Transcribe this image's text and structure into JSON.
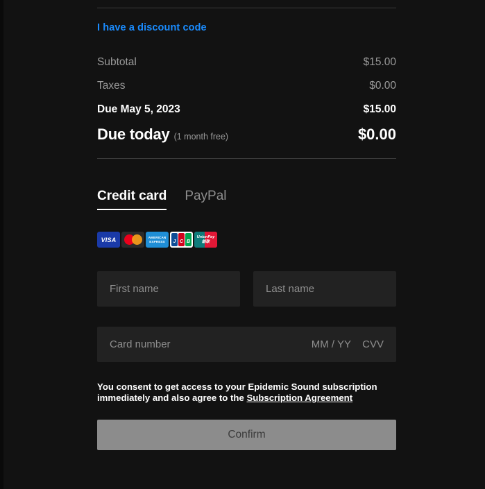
{
  "colors": {
    "background": "#121212",
    "link_blue": "#1a8cff",
    "muted_text": "#9a9a9a",
    "field_bg": "#222222",
    "confirm_bg": "#8c8c8c",
    "divider": "#3a3a3a"
  },
  "discount": {
    "link_label": "I have a discount code"
  },
  "summary": {
    "rows": [
      {
        "label": "Subtotal",
        "value": "$15.00"
      },
      {
        "label": "Taxes",
        "value": "$0.00"
      },
      {
        "label": "Due May 5, 2023",
        "value": "$15.00"
      }
    ],
    "total": {
      "label": "Due today",
      "note": "(1 month free)",
      "value": "$0.00"
    }
  },
  "payment": {
    "tabs": [
      {
        "label": "Credit card",
        "active": true
      },
      {
        "label": "PayPal",
        "active": false
      }
    ],
    "brands": [
      {
        "name": "visa-card-icon",
        "text": "VISA"
      },
      {
        "name": "mastercard-card-icon",
        "text": ""
      },
      {
        "name": "amex-card-icon",
        "line1": "AMERICAN",
        "line2": "EXPRESS"
      },
      {
        "name": "jcb-card-icon",
        "letters": [
          "J",
          "C",
          "B"
        ]
      },
      {
        "name": "unionpay-card-icon",
        "line1": "UnionPay",
        "line2": "銀联"
      }
    ]
  },
  "form": {
    "first_name": {
      "placeholder": "First name",
      "value": ""
    },
    "last_name": {
      "placeholder": "Last name",
      "value": ""
    },
    "card_number": {
      "placeholder": "Card number",
      "value": ""
    },
    "expiry": {
      "placeholder": "MM / YY",
      "value": ""
    },
    "cvv": {
      "placeholder": "CVV",
      "value": ""
    }
  },
  "consent": {
    "text": "You consent to get access to your Epidemic Sound subscription immediately and also agree to the ",
    "link_label": "Subscription Agreement"
  },
  "actions": {
    "confirm_label": "Confirm"
  }
}
